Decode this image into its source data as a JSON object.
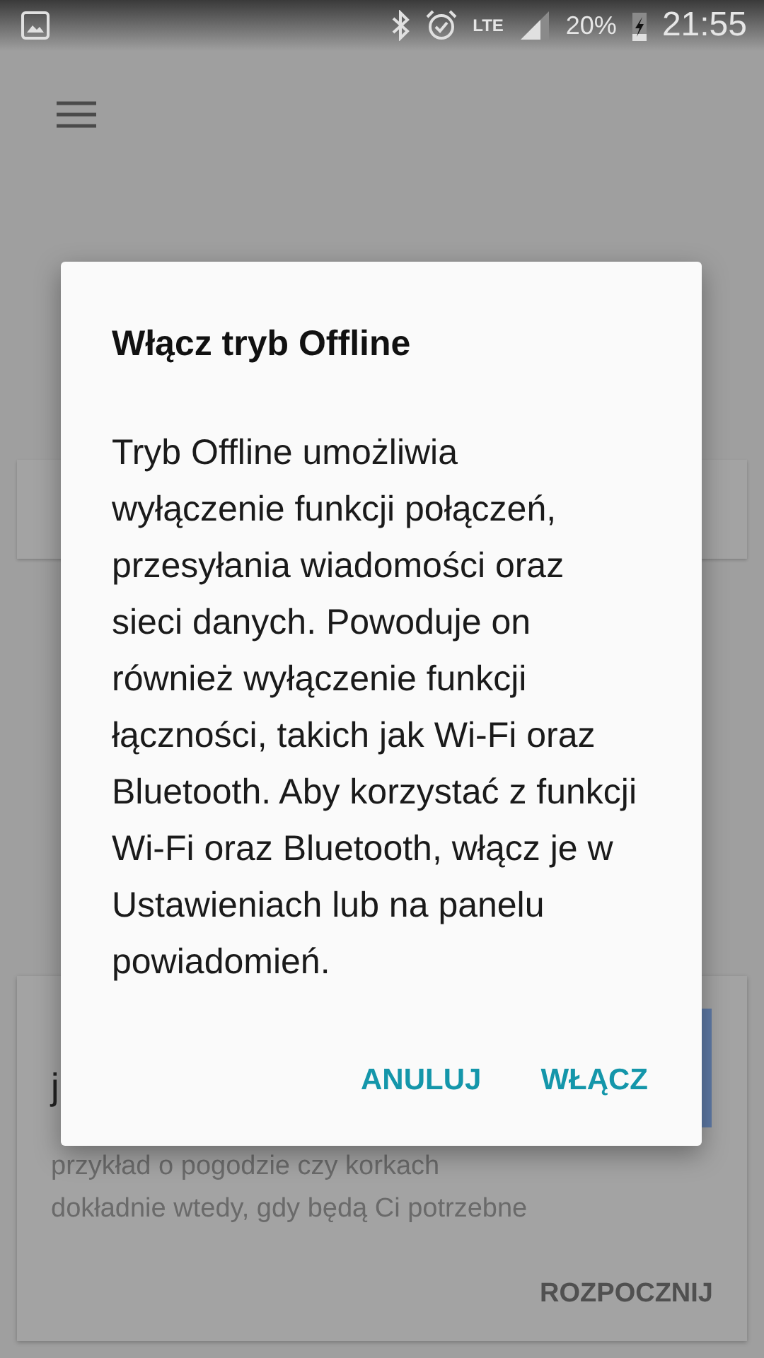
{
  "status_bar": {
    "network": "LTE",
    "battery": "20%",
    "time": "21:55"
  },
  "background_card": {
    "title_fragments": [
      "j"
    ],
    "body_lines": [
      "przykład o pogodzie czy korkach",
      "dokładnie wtedy, gdy będą Ci potrzebne"
    ],
    "action": "ROZPOCZNIJ"
  },
  "dialog": {
    "title": "Włącz tryb Offline",
    "message": "Tryb Offline umożliwia wyłączenie funkcji połączeń, przesyłania wiadomości oraz sieci danych. Powoduje on również wyłączenie funkcji łączności, takich jak Wi-Fi oraz Bluetooth. Aby korzystać z funkcji Wi-Fi oraz Bluetooth, włącz je w Ustawieniach lub na panelu powiadomień.",
    "buttons": [
      "ANULUJ",
      "WŁĄCZ"
    ]
  }
}
